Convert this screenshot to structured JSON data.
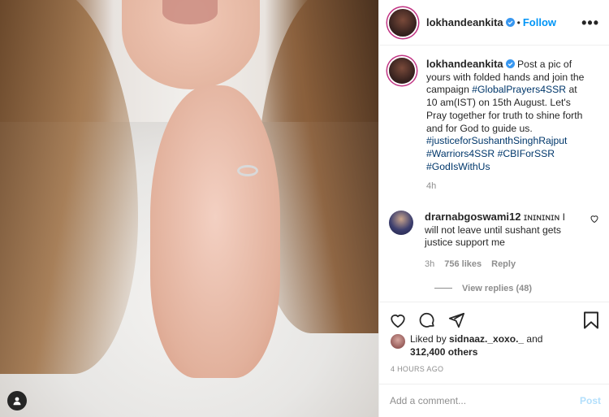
{
  "post": {
    "username": "lokhandeankita",
    "follow_label": "Follow",
    "separator": "•",
    "more_label": "•••",
    "caption_prefix": "Post a pic of yours with folded hands and join the campaign ",
    "caption_tag1": "#GlobalPrayers4SSR",
    "caption_mid": " at 10 am(IST) on 15th August. Let's Pray together for truth to shine forth and for God to guide us. ",
    "caption_tag2": "#justiceforSushanthSinghRajput",
    "caption_tag3": "#Warriors4SSR",
    "caption_tag4": "#CBIForSSR",
    "caption_tag5": "#GodIsWithUs",
    "caption_time": "4h"
  },
  "comment": {
    "username": "drarnabgoswami12",
    "text": "ɪɴɪɴɪɴɪɴ I will not leave until sushant gets justice support me",
    "time": "3h",
    "likes": "756 likes",
    "reply_label": "Reply",
    "view_replies": "View replies (48)"
  },
  "likes": {
    "prefix": "Liked by ",
    "user": "sidnaaz._xoxo._",
    "and": " and",
    "others": "312,400 others"
  },
  "timestamp": "4 HOURS AGO",
  "add_comment": {
    "placeholder": "Add a comment...",
    "post_label": "Post"
  },
  "colors": {
    "link": "#0095f6",
    "hashtag": "#00376b",
    "muted": "#8e8e8e",
    "verified": "#3897f0"
  },
  "icons": [
    "heart-icon",
    "comment-icon",
    "share-icon",
    "bookmark-icon",
    "user-tag-icon",
    "verified-badge-icon",
    "more-options-icon"
  ]
}
